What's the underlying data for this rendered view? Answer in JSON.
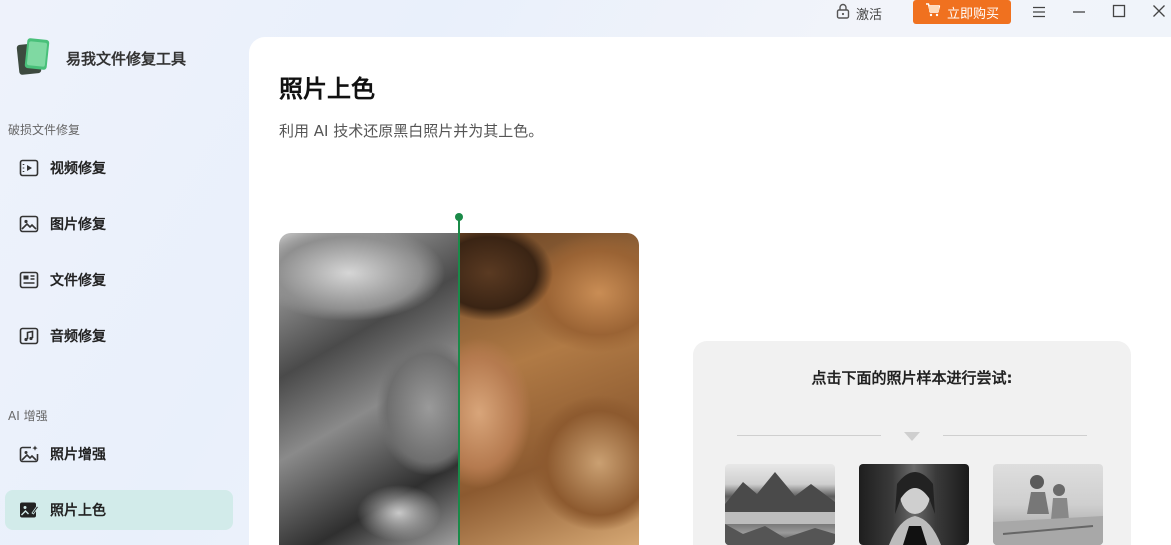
{
  "titlebar": {
    "activate_label": "激活",
    "buy_label": "立即购买",
    "accent_color": "#f0711f"
  },
  "app": {
    "title": "易我文件修复工具"
  },
  "sidebar": {
    "sections": [
      {
        "label": "破损文件修复"
      },
      {
        "label": "AI 增强"
      }
    ],
    "items": [
      {
        "label": "视频修复",
        "icon": "video-icon"
      },
      {
        "label": "图片修复",
        "icon": "image-icon"
      },
      {
        "label": "文件修复",
        "icon": "document-icon"
      },
      {
        "label": "音频修复",
        "icon": "music-icon"
      },
      {
        "label": "照片增强",
        "icon": "photo-enhance-icon"
      },
      {
        "label": "照片上色",
        "icon": "photo-colorize-icon",
        "active": true
      }
    ],
    "active_color": "#d2ebea"
  },
  "main": {
    "title": "照片上色",
    "subtitle": "利用 AI 技术还原黑白照片并为其上色。",
    "compare_line_color": "#1a8a48",
    "samples": {
      "title": "点击下面的照片样本进行尝试:",
      "items": [
        {
          "icon": "mountain-lake-thumbnail"
        },
        {
          "icon": "woman-portrait-thumbnail"
        },
        {
          "icon": "children-photo-thumbnail"
        }
      ]
    }
  }
}
